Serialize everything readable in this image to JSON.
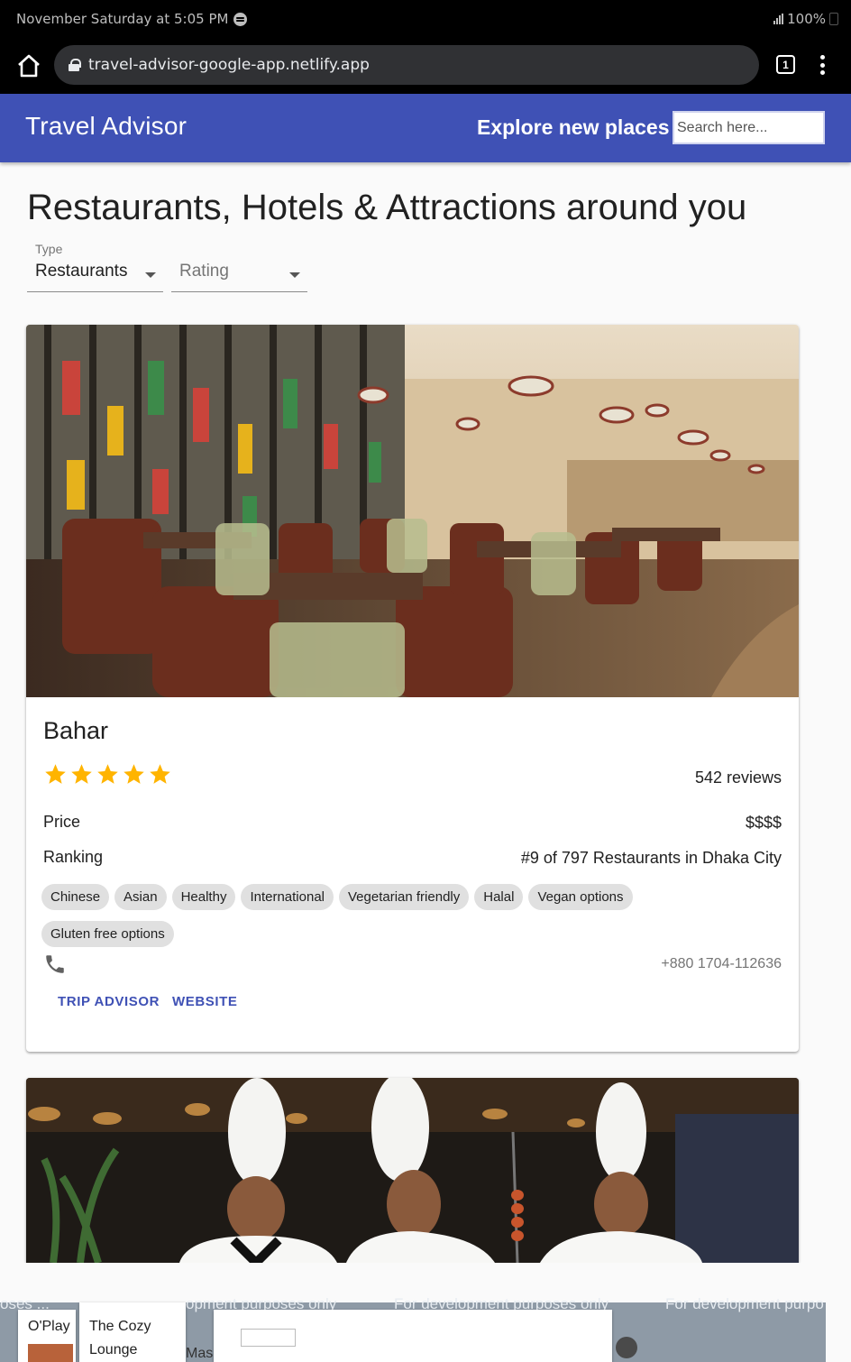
{
  "status": {
    "time": "November Saturday at 5:05 PM",
    "battery": "100%"
  },
  "browser": {
    "url": "travel-advisor-google-app.netlify.app",
    "tab_count": "1"
  },
  "appbar": {
    "title": "Travel Advisor",
    "explore": "Explore new places",
    "search_placeholder": "Search here..."
  },
  "page": {
    "heading": "Restaurants, Hotels & Attractions around you"
  },
  "filters": {
    "type_label": "Type",
    "type_value": "Restaurants",
    "rating_value": "Rating"
  },
  "places": [
    {
      "name": "Bahar",
      "rating": 5,
      "reviews": "542 reviews",
      "price_label": "Price",
      "price": "$$$$",
      "ranking_label": "Ranking",
      "ranking": "#9 of 797 Restaurants in Dhaka City",
      "cuisines": [
        "Chinese",
        "Asian",
        "Healthy",
        "International",
        "Vegetarian friendly",
        "Halal",
        "Vegan options",
        "Gluten free options"
      ],
      "phone": "+880 1704-112636",
      "buttons": {
        "trip_advisor": "TRIP ADVISOR",
        "website": "WEBSITE"
      }
    }
  ],
  "map": {
    "watermarks": [
      "opment purposes only",
      "For development purposes only",
      "For development purpo"
    ],
    "fragments": {
      "left": "oses ...",
      "mid": "Mas"
    },
    "cards": [
      "O'Play",
      "The Cozy Lounge"
    ]
  },
  "colors": {
    "primary": "#3f51b5",
    "star": "#ffb400",
    "chip": "#e0e0e0"
  }
}
